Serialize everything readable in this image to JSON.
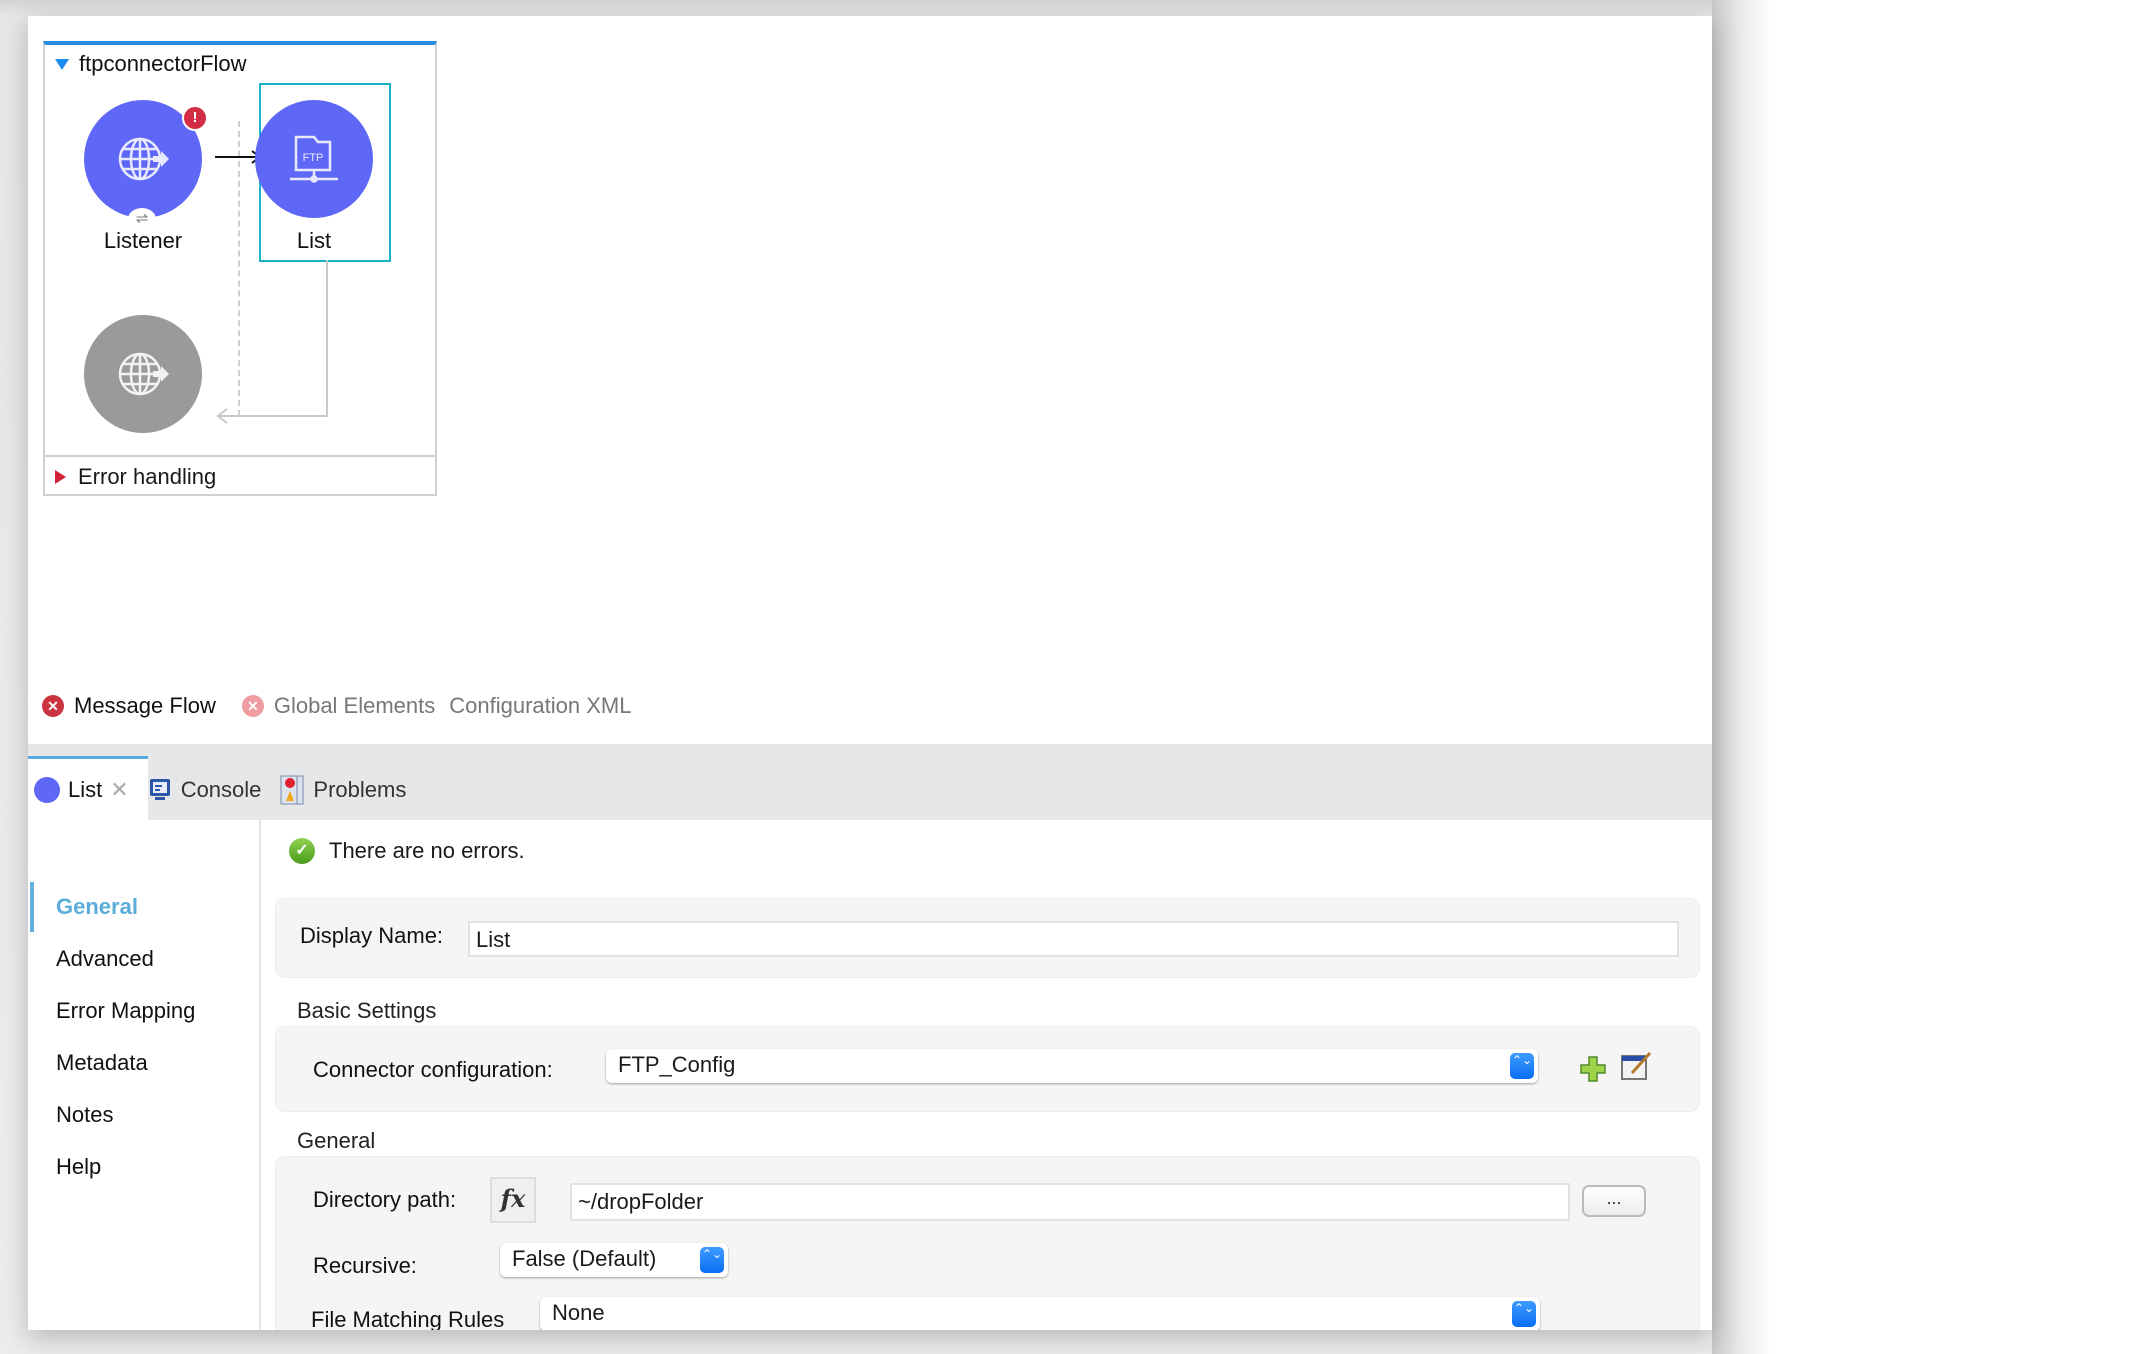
{
  "canvas": {
    "flow_name": "ftpconnectorFlow",
    "nodes": [
      {
        "label": "Listener",
        "icon": "http-listener-globe-icon",
        "has_error": true
      },
      {
        "label": "List",
        "icon": "ftp-folder-icon",
        "selected": true
      },
      {
        "label": "",
        "icon": "http-response-globe-icon"
      }
    ],
    "error_badge": "!",
    "sync_badge": "⇌",
    "ftp_text": "FTP",
    "error_handling_label": "Error handling"
  },
  "editor_tabs": [
    {
      "label": "Message Flow",
      "active": true,
      "has_error": true
    },
    {
      "label": "Global Elements",
      "active": false,
      "has_error": true
    },
    {
      "label": "Configuration XML",
      "active": false,
      "has_error": false
    }
  ],
  "error_glyph": "✕",
  "panel_tabs": [
    {
      "label": "List",
      "active": true,
      "closable": true
    },
    {
      "label": "Console",
      "active": false
    },
    {
      "label": "Problems",
      "active": false
    }
  ],
  "close_glyph": "✕",
  "left_nav": [
    {
      "label": "General",
      "active": true
    },
    {
      "label": "Advanced"
    },
    {
      "label": "Error Mapping"
    },
    {
      "label": "Metadata"
    },
    {
      "label": "Notes"
    },
    {
      "label": "Help"
    }
  ],
  "status": {
    "text": "There are no errors.",
    "glyph": "✓"
  },
  "form": {
    "display_name_label": "Display Name:",
    "display_name_value": "List",
    "basic_settings_label": "Basic Settings",
    "connector_config_label": "Connector configuration:",
    "connector_config_value": "FTP_Config",
    "general_label": "General",
    "directory_path_label": "Directory path:",
    "fx_label": "fx",
    "directory_path_value": "~/dropFolder",
    "browse_label": "...",
    "recursive_label": "Recursive:",
    "recursive_value": "False (Default)",
    "file_matching_label": "File Matching Rules",
    "file_matching_value": "None",
    "stepper_glyph": "⌃⌄"
  },
  "colors": {
    "accent": "#5f68f6",
    "selection": "#1ab0c8",
    "flow_header": "#2b8be0",
    "error": "#d22d44",
    "nav_active": "#5aaed9"
  }
}
